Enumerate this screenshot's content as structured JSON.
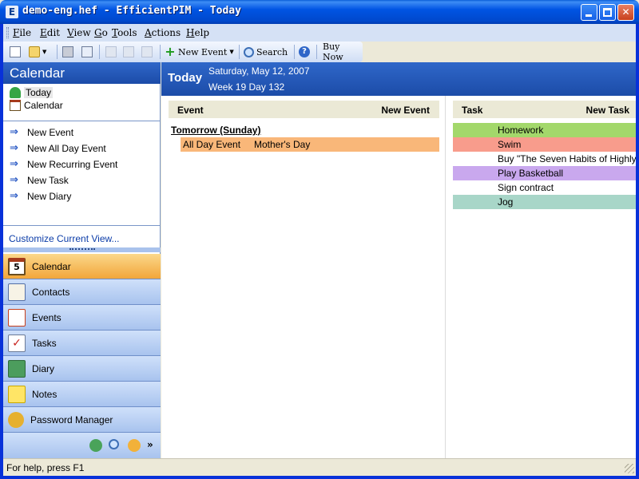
{
  "window": {
    "title": "demo-eng.hef - EfficientPIM - Today",
    "app_icon": "E"
  },
  "menu": [
    "File",
    "Edit",
    "View",
    "Go",
    "Tools",
    "Actions",
    "Help"
  ],
  "toolbar": {
    "new_event": "New Event",
    "search": "Search",
    "buy_now": "Buy Now"
  },
  "sidebar": {
    "title": "Calendar",
    "tree": [
      "Today",
      "Calendar"
    ],
    "actions": [
      "New Event",
      "New All Day Event",
      "New Recurring Event",
      "New Task",
      "New Diary"
    ],
    "customize": "Customize Current View...",
    "nav": [
      "Calendar",
      "Contacts",
      "Events",
      "Tasks",
      "Diary",
      "Notes",
      "Password Manager"
    ],
    "calendar_icon_day": "5"
  },
  "today": {
    "title": "Today",
    "date": "Saturday, May 12, 2007",
    "week": "Week 19 Day 132"
  },
  "events": {
    "header": "Event",
    "new_label": "New Event",
    "group": "Tomorrow (Sunday)",
    "items": [
      {
        "type": "All Day Event",
        "name": "Mother's Day",
        "color": "#f9b779"
      }
    ]
  },
  "tasks": {
    "header": "Task",
    "new_label": "New Task",
    "items": [
      {
        "name": "Homework",
        "color": "#a3d86b"
      },
      {
        "name": "Swim",
        "color": "#f89c8c"
      },
      {
        "name": "Buy \"The Seven Habits of Highly Effective People\"",
        "color": "#ffffff"
      },
      {
        "name": "Play Basketball",
        "color": "#c9a8ee"
      },
      {
        "name": "Sign contract",
        "color": "#ffffff"
      },
      {
        "name": "Jog",
        "color": "#a8d6c8"
      }
    ]
  },
  "status": "For help, press F1"
}
